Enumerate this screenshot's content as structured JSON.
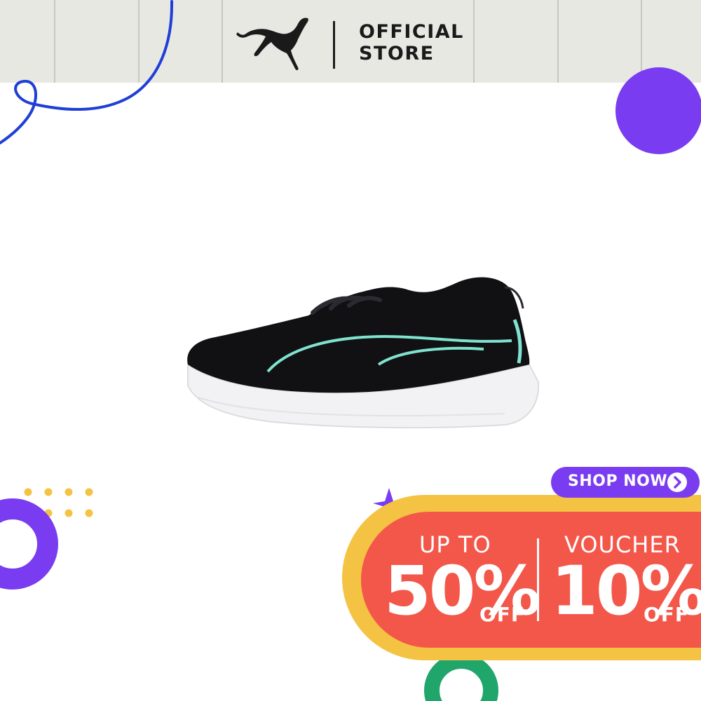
{
  "header": {
    "logo_icon": "puma-cat-icon",
    "brand_line_1": "OFFICIAL",
    "brand_line_2": "STORE"
  },
  "product": {
    "image": "black-running-shoe-mint-accent"
  },
  "promo": {
    "shop_now_label": "SHOP NOW",
    "shop_now_icon": "chevron-right-icon",
    "left_caption": "UP TO",
    "left_value": "50%",
    "left_suffix": "OFF",
    "right_caption": "VOUCHER",
    "right_value": "10%",
    "right_suffix": "OFF"
  },
  "colors": {
    "header_bg": "#e8e8e3",
    "purple": "#7a3cf0",
    "blue_line": "#1f3fd6",
    "yellow": "#f5c343",
    "red": "#f3574a",
    "green": "#20a56b",
    "mint": "#7fe3cf"
  }
}
